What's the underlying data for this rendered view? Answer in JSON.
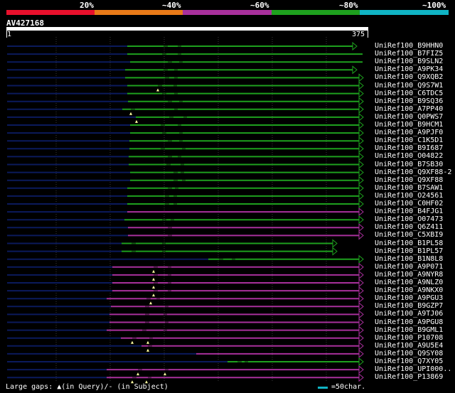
{
  "legend": {
    "labels": [
      "20%",
      "~40%",
      "~60%",
      "~80%",
      "~100%"
    ],
    "colors": [
      "#e8102c",
      "#e87a18",
      "#a8309c",
      "#1ea01e",
      "#10b4c4"
    ]
  },
  "query": {
    "name": "AV427168",
    "start": "1",
    "end": "375"
  },
  "hits": [
    {
      "label": "UniRef100_B9HHN0",
      "color": "#1ea01e",
      "end_mark": "triangle"
    },
    {
      "label": "UniRef100_B7FIZ5",
      "color": "#1ea01e"
    },
    {
      "label": "UniRef100_B9SLN2",
      "color": "#1ea01e"
    },
    {
      "label": "UniRef100_A9PK34",
      "color": "#1ea01e",
      "end_mark": "triangle"
    },
    {
      "label": "UniRef100_Q9XQB2",
      "color": "#1ea01e",
      "end_mark": "triangle"
    },
    {
      "label": "UniRef100_Q9S7W1",
      "color": "#1ea01e",
      "end_mark": "triangle"
    },
    {
      "label": "UniRef100_C6TDC5",
      "color": "#1ea01e",
      "end_mark": "triangle"
    },
    {
      "label": "UniRef100_B9SQ36",
      "color": "#1ea01e",
      "end_mark": "triangle"
    },
    {
      "label": "UniRef100_A7PP40",
      "color": "#1ea01e",
      "end_mark": "triangle"
    },
    {
      "label": "UniRef100_Q0PWS7",
      "color": "#1ea01e",
      "end_mark": "triangle"
    },
    {
      "label": "UniRef100_B9HCM1",
      "color": "#1ea01e",
      "end_mark": "triangle"
    },
    {
      "label": "UniRef100_A9PJF0",
      "color": "#1ea01e",
      "end_mark": "triangle"
    },
    {
      "label": "UniRef100_C1K5D1",
      "color": "#1ea01e",
      "end_mark": "triangle"
    },
    {
      "label": "UniRef100_B9I687",
      "color": "#1ea01e",
      "end_mark": "triangle"
    },
    {
      "label": "UniRef100_O04822",
      "color": "#1ea01e",
      "end_mark": "triangle"
    },
    {
      "label": "UniRef100_B7SB30",
      "color": "#1ea01e",
      "end_mark": "triangle"
    },
    {
      "label": "UniRef100_Q9XF88-2",
      "color": "#1ea01e",
      "end_mark": "triangle"
    },
    {
      "label": "UniRef100_Q9XF88",
      "color": "#1ea01e",
      "end_mark": "triangle"
    },
    {
      "label": "UniRef100_B7SAW1",
      "color": "#1ea01e",
      "end_mark": "triangle"
    },
    {
      "label": "UniRef100_O24561",
      "color": "#1ea01e",
      "end_mark": "triangle"
    },
    {
      "label": "UniRef100_C0HF02",
      "color": "#1ea01e",
      "end_mark": "triangle"
    },
    {
      "label": "UniRef100_B4FJG1",
      "color": "#a8309c",
      "end_mark": "triangle"
    },
    {
      "label": "UniRef100_O07473",
      "color": "#1ea01e",
      "end_mark": "triangle"
    },
    {
      "label": "UniRef100_Q6Z411",
      "color": "#a8309c",
      "end_mark": "triangle"
    },
    {
      "label": "UniRef100_C5XBI9",
      "color": "#a8309c",
      "end_mark": "triangle"
    },
    {
      "label": "UniRef100_B1PL58",
      "color": "#1ea01e",
      "end_mark": "triangle"
    },
    {
      "label": "UniRef100_B1PL57",
      "color": "#1ea01e",
      "end_mark": "triangle"
    },
    {
      "label": "UniRef100_B1N8L8",
      "color": "#1ea01e",
      "end_mark": "triangle"
    },
    {
      "label": "UniRef100_A9P071",
      "color": "#a8309c",
      "end_mark": "triangle"
    },
    {
      "label": "UniRef100_A9NYR8",
      "color": "#a8309c",
      "end_mark": "triangle"
    },
    {
      "label": "UniRef100_A9NLZ0",
      "color": "#a8309c",
      "end_mark": "triangle"
    },
    {
      "label": "UniRef100_A9NKX0",
      "color": "#a8309c",
      "end_mark": "triangle"
    },
    {
      "label": "UniRef100_A9PGU3",
      "color": "#a8309c",
      "end_mark": "triangle"
    },
    {
      "label": "UniRef100_B9GZP7",
      "color": "#a8309c",
      "end_mark": "triangle"
    },
    {
      "label": "UniRef100_A9TJ06",
      "color": "#a8309c",
      "end_mark": "triangle"
    },
    {
      "label": "UniRef100_A9PGU8",
      "color": "#a8309c",
      "end_mark": "triangle"
    },
    {
      "label": "UniRef100_B9GML1",
      "color": "#a8309c",
      "end_mark": "triangle"
    },
    {
      "label": "UniRef100_P10708",
      "color": "#a8309c",
      "end_mark": "triangle"
    },
    {
      "label": "UniRef100_A9U5E4",
      "color": "#a8309c",
      "end_mark": "triangle"
    },
    {
      "label": "UniRef100_Q9SY08",
      "color": "#a8309c",
      "end_mark": "triangle"
    },
    {
      "label": "UniRef100_Q7XY05",
      "color": "#1ea01e",
      "end_mark": "triangle"
    },
    {
      "label": "UniRef100_UPI000..",
      "color": "#a8309c",
      "end_mark": "triangle"
    },
    {
      "label": "UniRef100_P13869",
      "color": "#a8309c",
      "end_mark": "triangle"
    }
  ],
  "footer": {
    "gaps_text": "Large gaps: ▲(in Query)/- (in Subject)",
    "scale_text": "=50char.",
    "scale_color": "#10b4c4"
  }
}
